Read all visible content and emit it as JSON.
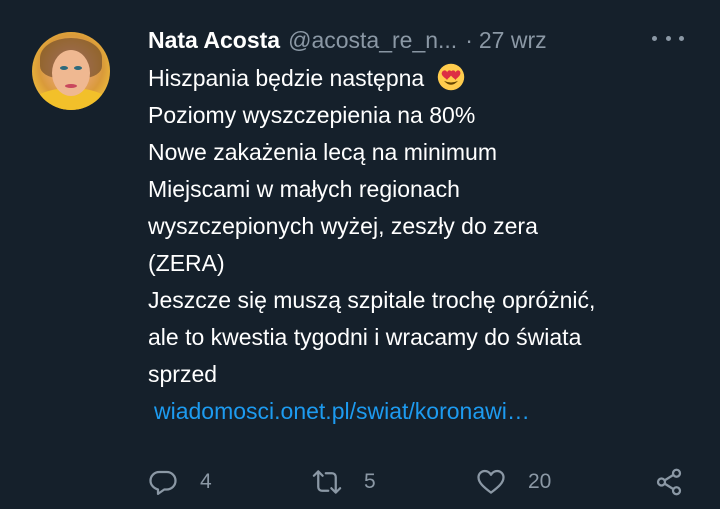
{
  "tweet": {
    "author": {
      "name": "Nata Acosta",
      "handle": "@acosta_re_n...",
      "avatar_icon": "avatar-photo"
    },
    "separator": "·",
    "time": "27 wrz",
    "more_icon": "more-options-icon",
    "lines": [
      "Hiszpania będzie następna",
      "Poziomy wyszczepienia na 80%",
      "Nowe zakażenia lecą na minimum",
      "Miejscami w małych regionach",
      "wyszczepionych wyżej, zeszły do zera",
      "(ZERA)",
      "Jeszcze się muszą szpitale trochę opróżnić,",
      "ale to kwestia tygodni i wracamy do świata",
      "sprzed"
    ],
    "emoji_icon": "heart-eyes-emoji",
    "link": "wiadomosci.onet.pl/swiat/koronawi…",
    "actions": {
      "reply_count": "4",
      "retweet_count": "5",
      "like_count": "20"
    }
  },
  "colors": {
    "background": "#15202b",
    "text": "#ffffff",
    "secondary": "#8b98a5",
    "link": "#1d9bf0"
  }
}
